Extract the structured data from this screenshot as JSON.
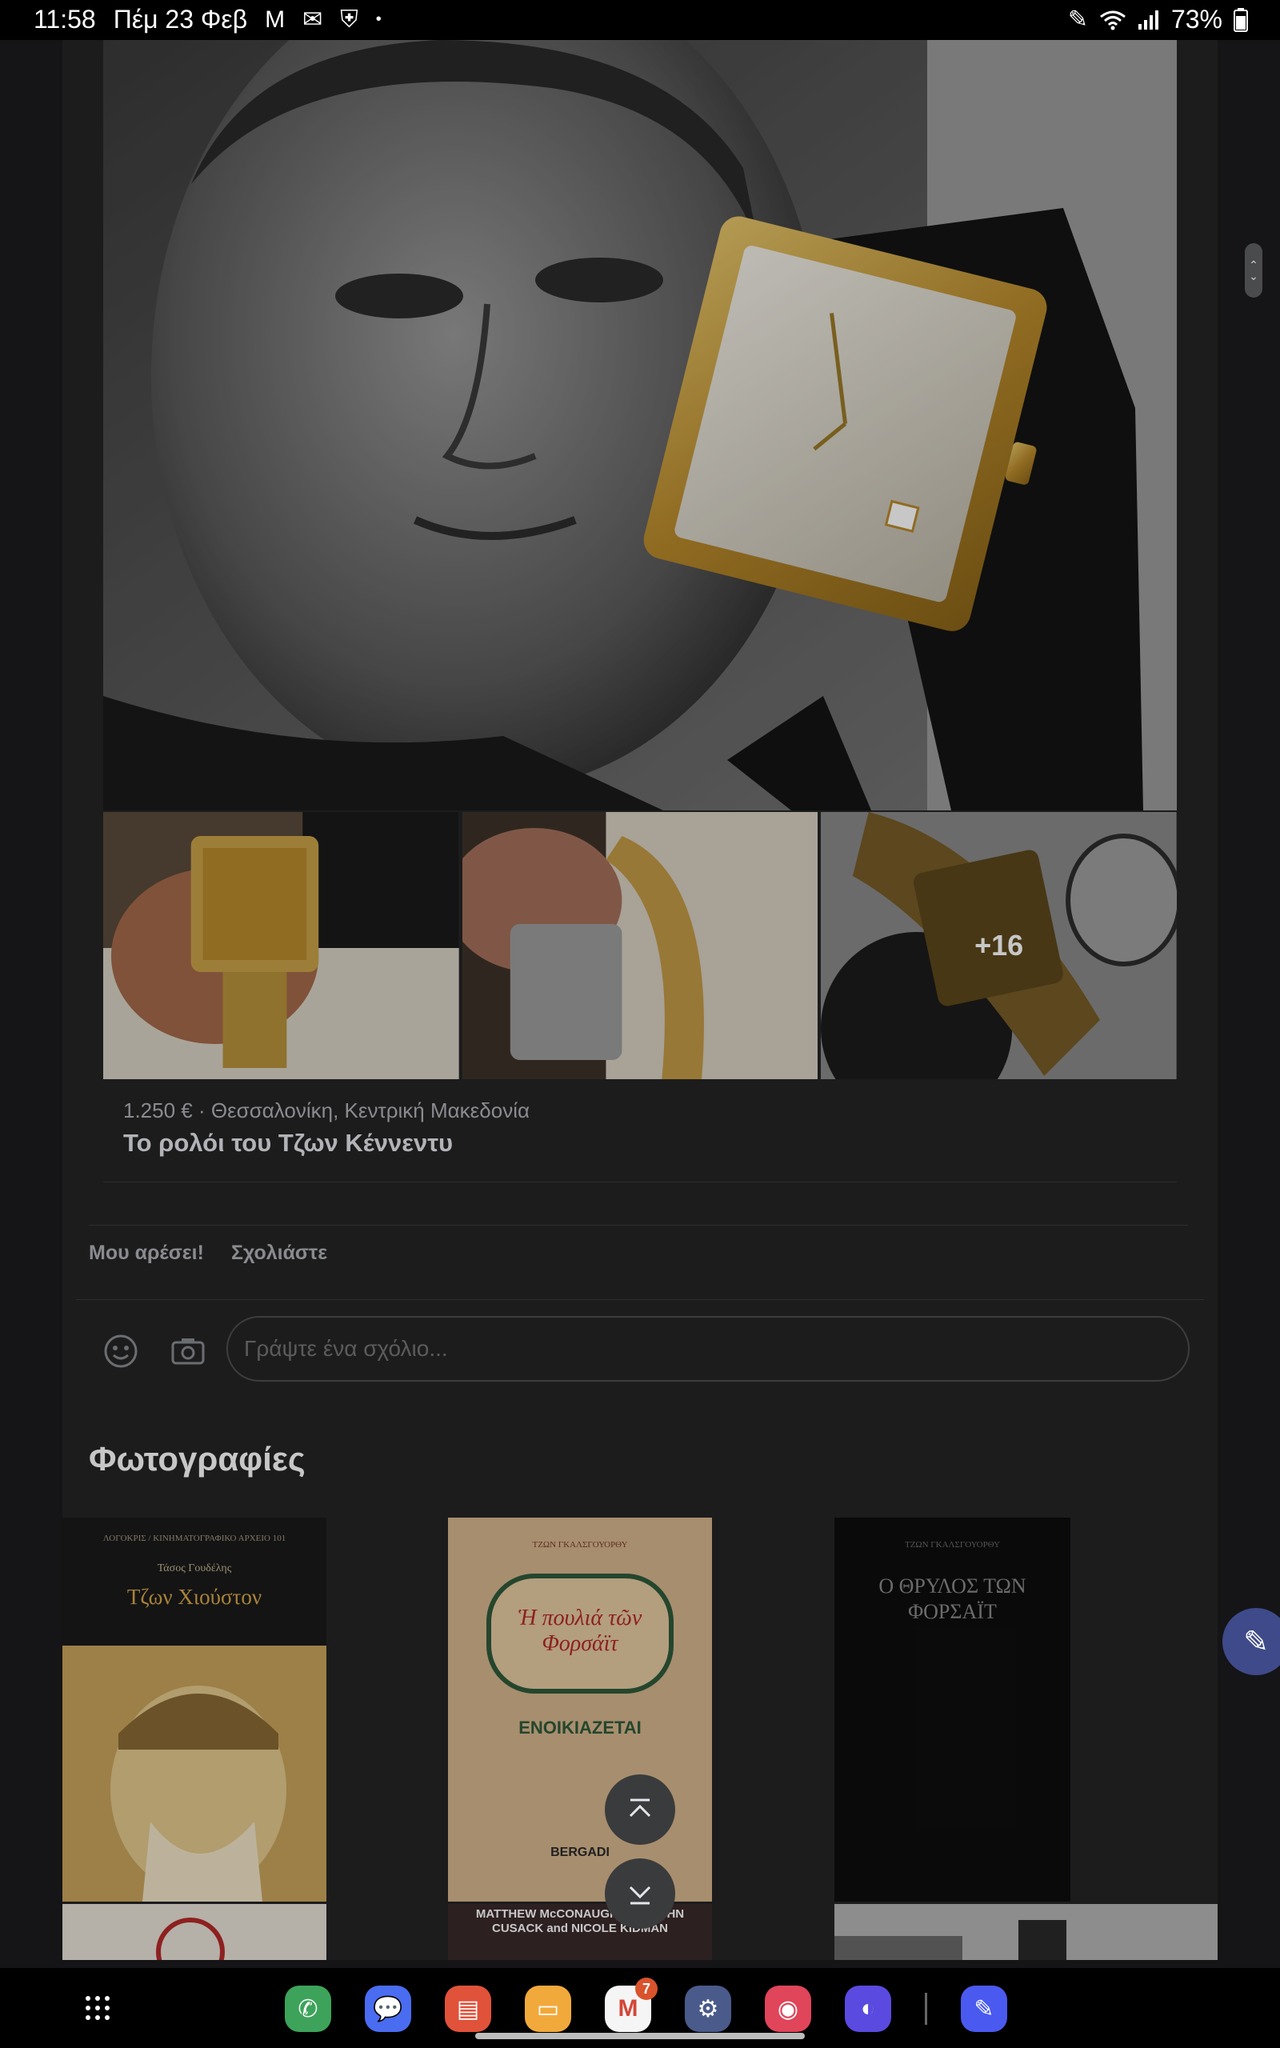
{
  "status_bar": {
    "time": "11:58",
    "date": "Πέμ 23 Φεβ",
    "battery": "73%",
    "icons_left": [
      "gmail-icon",
      "mail-icon",
      "shield-icon",
      "dot-icon"
    ],
    "icons_right": [
      "pen-icon",
      "wifi-icon",
      "signal-icon",
      "battery-icon"
    ]
  },
  "post": {
    "hero_alt": "",
    "more_photos_label": "+16",
    "listing": {
      "price_location": "1.250 € · Θεσσαλονίκη, Κεντρική Μακεδονία",
      "title": "Το ρολόι του Τζων Κέννεντυ"
    },
    "actions": {
      "like_label": "Μου αρέσει!",
      "comment_label": "Σχολιάστε"
    },
    "comment": {
      "placeholder": "Γράψτε ένα σχόλιο..."
    }
  },
  "photos": {
    "title": "Φωτογραφίες",
    "items": [
      {
        "top_text": "ΛΟΓΟΚΡΙΣ / ΚΙΝΗΜΑΤΟΓΡΑΦΙΚΟ ΑΡΧΕΙΟ 101",
        "author": "Τάσος Γουδέλης",
        "title": "Τζων Χιούστον"
      },
      {
        "top_text": "ΤΖΩΝ ΓΚΑΛΣΓΟΥΟΡΘΥ",
        "title": "Ἡ πουλιά τῶν Φορσάϊτ",
        "subtitle": "ΕΝΟΙΚΙΑΖΕΤΑΙ",
        "publisher": "BERGADI"
      },
      {
        "top_text": "ΤΖΩΝ ΓΚΑΛΣΓΟΥΟΡΘΥ",
        "title": "Ο ΘΡΥΛΟΣ ΤΩΝ ΦΟΡΣΑΪΤ"
      },
      {
        "top_text": "MATTHEW McCONAUGHEY ... JOHN CUSACK and NICOLE KIDMAN"
      }
    ]
  },
  "dock": {
    "gmail_badge": "7",
    "apps": [
      "phone-app",
      "messages-app",
      "notes-app",
      "files-app",
      "gmail-app",
      "settings-app",
      "camera-app",
      "browser-app",
      "pen-app"
    ]
  },
  "colors": {
    "background": "#1c1c1e",
    "card": "#242526",
    "text": "#e4e6eb",
    "secondary_text": "#b0b3b8",
    "fab_accent": "#3f4a8a"
  }
}
